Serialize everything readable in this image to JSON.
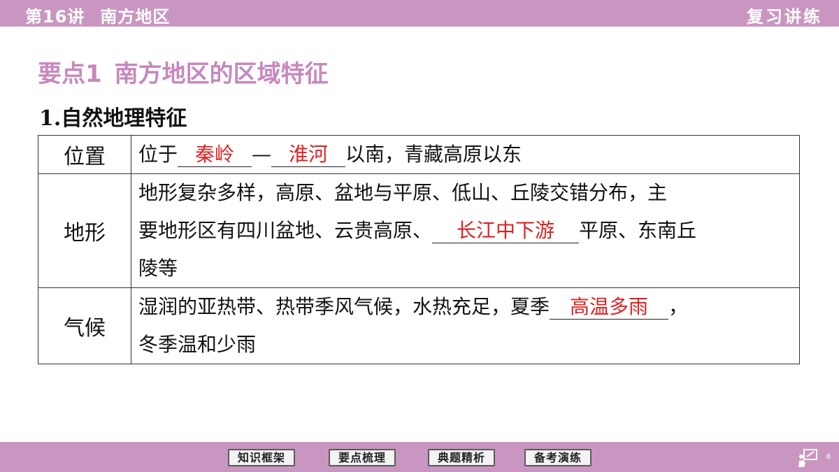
{
  "header": {
    "lesson_no": "第16讲",
    "lesson_title": "南方地区",
    "tag": "复习讲练"
  },
  "section": {
    "number": "要点1",
    "title": "南方地区的区域特征"
  },
  "subsection": "1.自然地理特征",
  "table": {
    "rows": [
      {
        "label": "位置",
        "text_before": "位于",
        "blank1": "秦岭",
        "dash": "—",
        "blank2": "淮河",
        "text_after": "以南，青藏高原以东"
      },
      {
        "label": "地形",
        "line1": "地形复杂多样，高原、盆地与平原、低山、丘陵交错分布，主",
        "line2_before": "要地形区有四川盆地、云贵高原、",
        "blank": "长江中下游",
        "line2_after": "平原、东南丘",
        "line3": "陵等"
      },
      {
        "label": "气候",
        "line1_before": "湿润的亚热带、热带季风气候，水热充足，夏季",
        "blank": "高温多雨",
        "line1_after": "，",
        "line2": "冬季温和少雨"
      }
    ]
  },
  "footer": {
    "buttons": [
      "知识框架",
      "要点梳理",
      "典题精析",
      "备考演练"
    ],
    "page_number": "8"
  },
  "colors": {
    "bar": "#c996c1",
    "section_title": "#c788be",
    "answer_red": "#e02020"
  }
}
